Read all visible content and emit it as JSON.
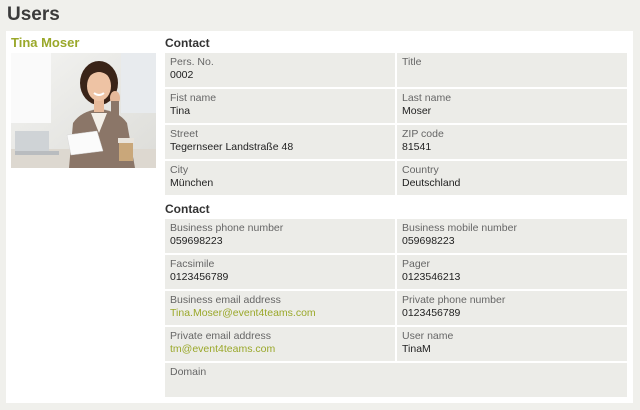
{
  "page": {
    "title": "Users"
  },
  "profile": {
    "name": "Tina Moser",
    "photo_icon": "user-photo"
  },
  "sections": [
    {
      "title": "Contact",
      "fields": [
        {
          "label": "Pers. No.",
          "value": "0002"
        },
        {
          "label": "Title",
          "value": ""
        },
        {
          "label": "Fist name",
          "value": "Tina"
        },
        {
          "label": "Last name",
          "value": "Moser"
        },
        {
          "label": "Street",
          "value": "Tegernseer Landstraße 48"
        },
        {
          "label": "ZIP code",
          "value": "81541"
        },
        {
          "label": "City",
          "value": "München"
        },
        {
          "label": "Country",
          "value": "Deutschland"
        }
      ]
    },
    {
      "title": "Contact",
      "fields": [
        {
          "label": "Business phone number",
          "value": "059698223"
        },
        {
          "label": "Business mobile number",
          "value": "059698223"
        },
        {
          "label": "Facsimile",
          "value": "0123456789"
        },
        {
          "label": "Pager",
          "value": "0123546213"
        },
        {
          "label": "Business email address",
          "value": "Tina.Moser@event4teams.com"
        },
        {
          "label": "Private phone number",
          "value": "0123456789"
        },
        {
          "label": "Private email address",
          "value": "tm@event4teams.com"
        },
        {
          "label": "User name",
          "value": "TinaM"
        },
        {
          "label": "Domain",
          "value": ""
        }
      ]
    }
  ],
  "colors": {
    "accent": "#9aa82a",
    "cell_bg": "#ecece8",
    "page_bg": "#f0f0ec"
  }
}
